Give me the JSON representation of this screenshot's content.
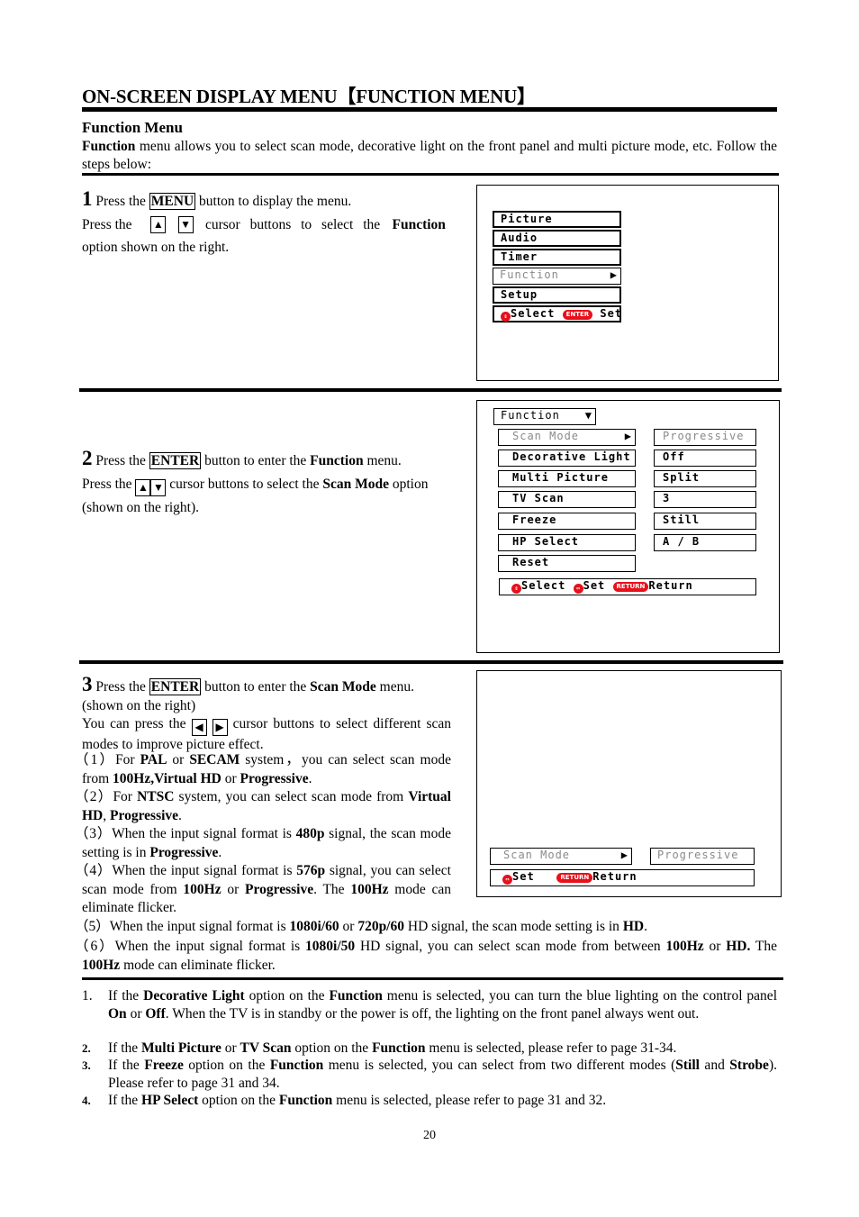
{
  "page": {
    "title": "ON-SCREEN DISPLAY MENU【FUNCTION MENU】",
    "subheading": "Function Menu",
    "intro_bold": "Function",
    "intro_rest": " menu allows you to select scan mode, decorative light on the front panel and multi picture mode, etc. Follow the steps below:",
    "page_number": "20"
  },
  "step1": {
    "num": "1",
    "line1_pre": " Press the ",
    "line1_key": "MENU",
    "line1_post": " button to display the menu.",
    "line2_pre": "Press the",
    "up": "▲",
    "down": "▼",
    "line2_mid": "cursor buttons to select the",
    "line2_bold": "Function",
    "line3": "option shown on the right."
  },
  "osd1": {
    "items": [
      "Picture",
      "Audio",
      "Timer",
      "Function",
      "Setup"
    ],
    "selected": "Function",
    "arrow": "▶",
    "footer_select": "Select",
    "footer_enter": "ENTER",
    "footer_set": "Set"
  },
  "step2": {
    "num": "2",
    "line1_pre": " Press the ",
    "line1_key": "ENTER",
    "line1_mid": " button to enter the ",
    "line1_bold": "Function",
    "line1_post": " menu.",
    "line2_pre": "Press the ",
    "up": "▲",
    "down": "▼",
    "line2_mid": " cursor buttons to select the ",
    "line2_bold": "Scan Mode",
    "line2_post": " option",
    "line3": "(shown on the right)."
  },
  "osd2": {
    "header": "Function",
    "header_arrow": "▼",
    "rows": [
      {
        "label": "Scan Mode",
        "value": "Progressive",
        "selected": true
      },
      {
        "label": "Decorative Light",
        "value": "Off"
      },
      {
        "label": "Multi Picture",
        "value": "Split"
      },
      {
        "label": "TV Scan",
        "value": "3"
      },
      {
        "label": "Freeze",
        "value": "Still"
      },
      {
        "label": "HP Select",
        "value": "A / B"
      },
      {
        "label": "Reset",
        "value": ""
      }
    ],
    "arrow": "▶",
    "footer_select": "Select",
    "footer_set": "Set",
    "footer_return_pill": "RETURN",
    "footer_return": "Return"
  },
  "step3": {
    "num": "3",
    "line1_pre": " Press the ",
    "line1_key": "ENTER",
    "line1_mid": " button to enter the ",
    "line1_bold": "Scan Mode",
    "line1_post": " menu.",
    "line2": "(shown on the right)",
    "line3_pre": "You can press the ",
    "left": "◀",
    "right": "▶",
    "line3_post": " cursor buttons to select different scan modes to improve picture effect.",
    "notes": [
      {
        "n": "（1）",
        "html": "For <b>PAL</b> or <b>SECAM</b> system，you can select scan mode from <b>100Hz,Virtual HD</b> or <b>Progressive</b>."
      },
      {
        "n": "（2）",
        "html": "For <b>NTSC</b> system, you can select scan mode from <b>Virtual HD</b>, <b>Progressive</b>."
      },
      {
        "n": "（3）",
        "html": "When the input signal format is <b>480p</b> signal, the scan mode setting is in <b>Progressive</b>."
      },
      {
        "n": "（4）",
        "html": "When the input signal format is <b>576p</b> signal, you can select scan mode from <b>100Hz</b> or <b>Progressive</b>. The <b>100Hz</b> mode can eliminate flicker."
      },
      {
        "n": "（5）",
        "html": "When the input signal format is <b>1080i/60</b> or <b>720p/60</b> HD signal, the scan mode setting is in <b>HD</b>."
      },
      {
        "n": "（6）",
        "html": "When the input signal format is <b>1080i/50</b> HD signal, you can select scan mode from between <b>100Hz</b> or <b>HD.</b> The <b>100Hz</b> mode can eliminate flicker."
      }
    ]
  },
  "osd3": {
    "label": "Scan Mode",
    "arrow": "▶",
    "value": "Progressive",
    "footer_set": "Set",
    "footer_return_pill": "RETURN",
    "footer_return": "Return"
  },
  "notes": [
    {
      "n": "1.",
      "html": "If the <b>Decorative Light</b> option on the <b>Function</b> menu is selected, you can turn the blue lighting on the control panel <b>On</b> or <b>Off</b>. When the TV is in standby or the power is off, the lighting on the front panel always went out."
    },
    {
      "n": "2.",
      "html": "If the <b>Multi Picture</b> or <b>TV Scan</b> option on the <b>Function</b> menu is selected, please refer to page 31-34."
    },
    {
      "n": "3.",
      "html": "If the <b>Freeze</b> option on the <b>Function</b> menu is selected, you can select from two different modes (<b>Still</b> and <b>Strobe</b>). Please refer to page 31 and 34."
    },
    {
      "n": "4.",
      "html": "If the <b>HP Select</b> option on the <b>Function</b> menu is selected, please refer to page 31 and 32."
    }
  ],
  "colors": {
    "accent_red": "#e8101a",
    "dim_text": "#8a8a8a"
  }
}
